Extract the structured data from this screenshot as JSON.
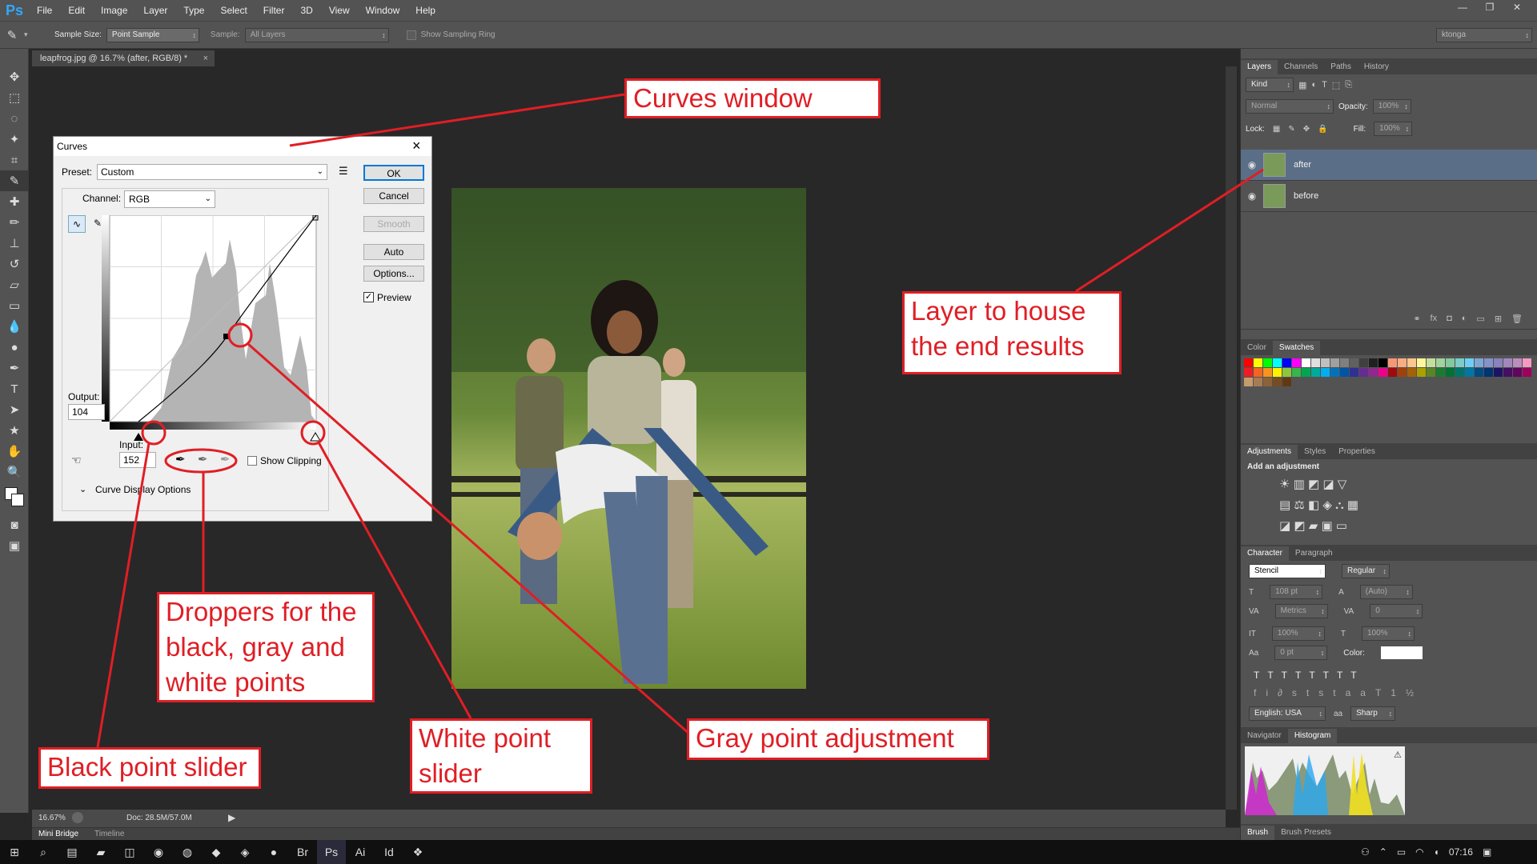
{
  "app": {
    "logo": "Ps"
  },
  "menu": [
    "File",
    "Edit",
    "Image",
    "Layer",
    "Type",
    "Select",
    "Filter",
    "3D",
    "View",
    "Window",
    "Help"
  ],
  "options_bar": {
    "sample_size_label": "Sample Size:",
    "sample_size_value": "Point Sample",
    "sample_label": "Sample:",
    "sample_value": "All Layers",
    "sampling_ring_label": "Show Sampling Ring",
    "workspace": "ktonga"
  },
  "document_tab": {
    "title": "leapfrog.jpg @ 16.7% (after, RGB/8) *",
    "close": "×"
  },
  "status_bar": {
    "zoom": "16.67%",
    "doc": "Doc: 28.5M/57.0M"
  },
  "bottom_tabs": [
    "Mini Bridge",
    "Timeline"
  ],
  "curves": {
    "title": "Curves",
    "close": "×",
    "preset_label": "Preset:",
    "preset_value": "Custom",
    "channel_label": "Channel:",
    "channel_value": "RGB",
    "output_label": "Output:",
    "output_value": "104",
    "input_label": "Input:",
    "input_value": "152",
    "show_clipping": "Show Clipping",
    "display_options": "Curve Display Options",
    "buttons": {
      "ok": "OK",
      "cancel": "Cancel",
      "smooth": "Smooth",
      "auto": "Auto",
      "options": "Options..."
    },
    "preview_label": "Preview",
    "preview_checked": true
  },
  "layers_panel": {
    "tabs": [
      "Layers",
      "Channels",
      "Paths",
      "History"
    ],
    "kind": "Kind",
    "blend_mode": "Normal",
    "opacity_label": "Opacity:",
    "opacity_value": "100%",
    "lock_label": "Lock:",
    "fill_label": "Fill:",
    "fill_value": "100%",
    "layers": [
      {
        "name": "after",
        "selected": true
      },
      {
        "name": "before",
        "selected": false
      }
    ]
  },
  "swatches_panel": {
    "tabs": [
      "Color",
      "Swatches"
    ]
  },
  "adjustments_panel": {
    "tabs": [
      "Adjustments",
      "Styles",
      "Properties"
    ],
    "heading": "Add an adjustment"
  },
  "character_panel": {
    "tabs": [
      "Character",
      "Paragraph"
    ],
    "font_family": "Stencil",
    "font_style": "Regular",
    "size": "108 pt",
    "leading": "(Auto)",
    "kerning": "Metrics",
    "tracking": "0",
    "vscale": "100%",
    "hscale": "100%",
    "baseline": "0 pt",
    "color_label": "Color:",
    "language": "English: USA",
    "aa_label": "aa",
    "antialias": "Sharp"
  },
  "histogram_panel": {
    "tabs": [
      "Navigator",
      "Histogram"
    ]
  },
  "brush_tabs": [
    "Brush",
    "Brush Presets"
  ],
  "taskbar": {
    "time": "07:16"
  },
  "annotations": {
    "curves_window": "Curves window",
    "layer_house": [
      "Layer to house",
      "the end results"
    ],
    "droppers": [
      "Droppers for the",
      "black, gray and",
      "white points"
    ],
    "black_slider": "Black point slider",
    "white_slider": [
      "White point",
      "slider"
    ],
    "gray_point": "Gray point adjustment"
  },
  "colors": {
    "annotation_red": "#e01e25",
    "ps_blue": "#31a8ff",
    "selected_layer": "#5b6e87"
  }
}
